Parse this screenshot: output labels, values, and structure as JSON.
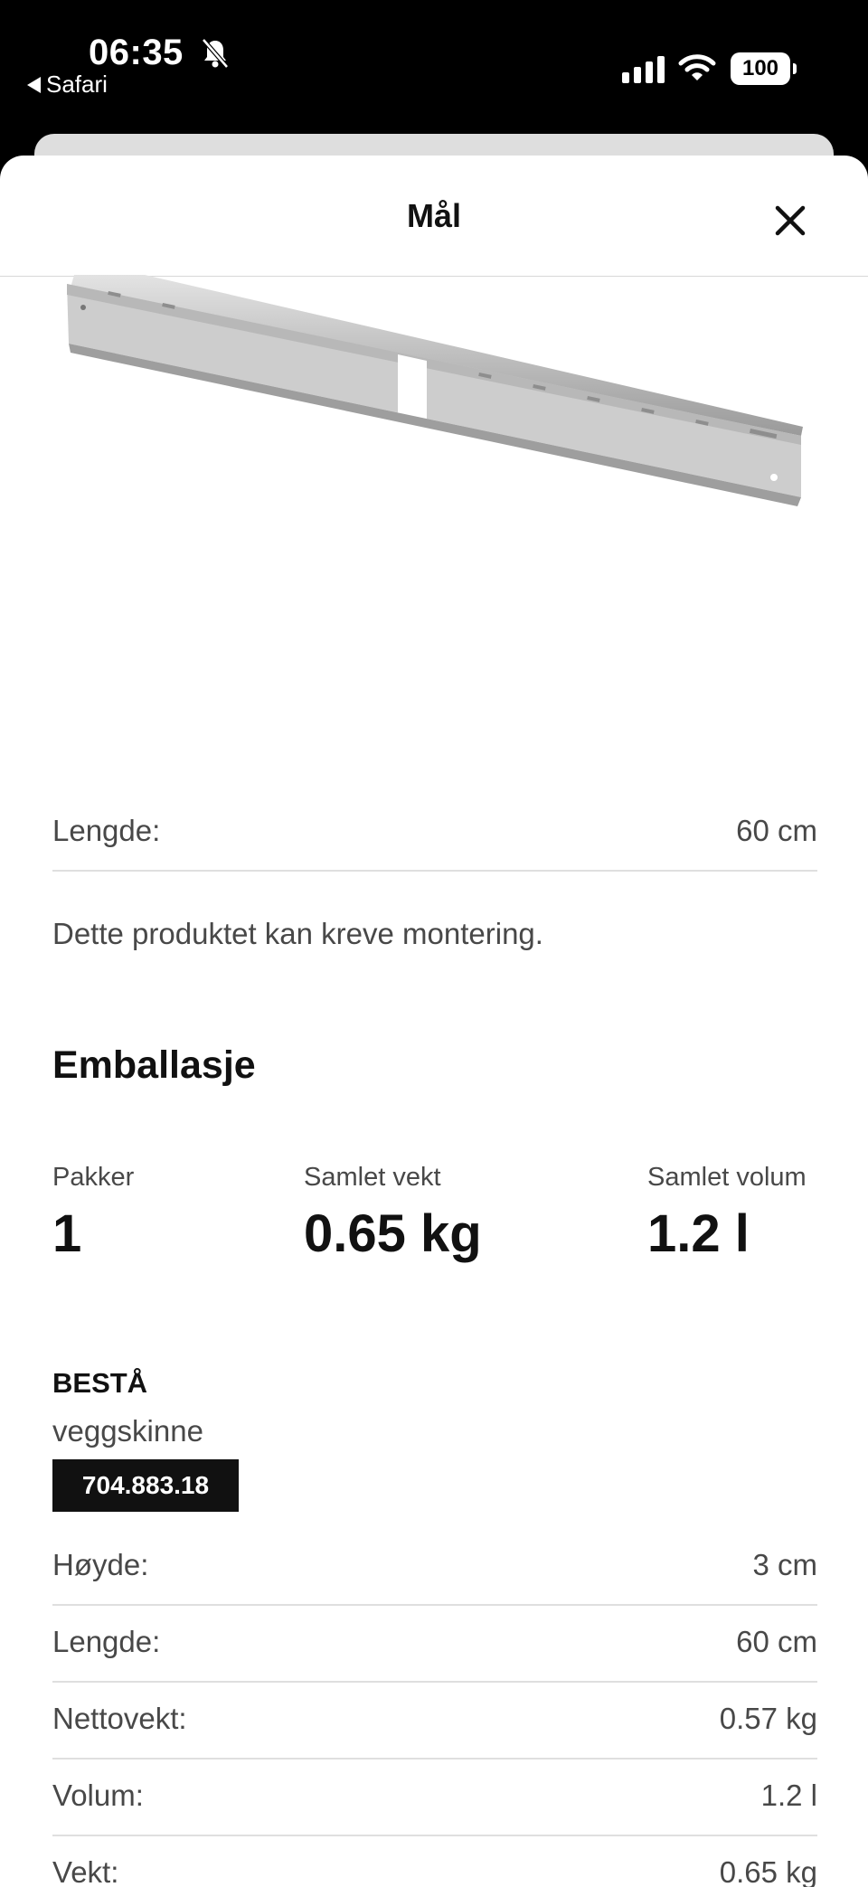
{
  "status_bar": {
    "time": "06:35",
    "back_app": "Safari",
    "battery": "100",
    "icons": [
      "bell-off-icon",
      "signal-icon",
      "wifi-icon",
      "battery-icon"
    ]
  },
  "sheet": {
    "title": "Mål",
    "close_icon": "close-icon"
  },
  "dimensions": {
    "rows": [
      {
        "label": "Lengde:",
        "value": "60 cm"
      }
    ],
    "note": "Dette produktet kan kreve montering."
  },
  "packaging": {
    "title": "Emballasje",
    "stats": [
      {
        "label": "Pakker",
        "value": "1"
      },
      {
        "label": "Samlet vekt",
        "value": "0.65 kg"
      },
      {
        "label": "Samlet volum",
        "value": "1.2 l"
      }
    ]
  },
  "product": {
    "name": "BESTÅ",
    "description": "veggskinne",
    "article_number": "704.883.18",
    "specs": [
      {
        "label": "Høyde:",
        "value": "3 cm"
      },
      {
        "label": "Lengde:",
        "value": "60 cm"
      },
      {
        "label": "Nettovekt:",
        "value": "0.57 kg"
      },
      {
        "label": "Volum:",
        "value": "1.2 l"
      },
      {
        "label": "Vekt:",
        "value": "0.65 kg"
      }
    ]
  }
}
